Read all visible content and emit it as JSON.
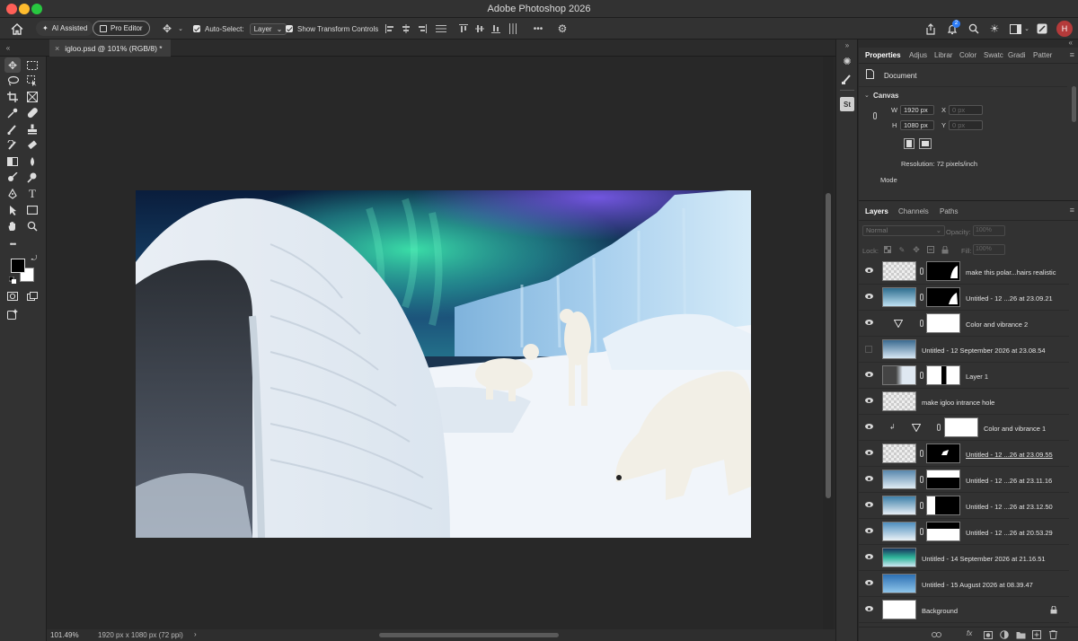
{
  "window": {
    "title": "Adobe Photoshop 2026"
  },
  "options_bar": {
    "ai_assisted": "AI Assisted",
    "pro_editor": "Pro Editor",
    "auto_select_label": "Auto-Select:",
    "auto_select_value": "Layer",
    "show_transform": "Show Transform Controls",
    "more": "•••"
  },
  "document": {
    "tab": "igloo.psd @ 101% (RGB/8) *"
  },
  "status": {
    "zoom": "101.49%",
    "info": "1920 px x 1080 px (72 ppi)",
    "arrow": "›"
  },
  "side_strip": {
    "stock_label": "St"
  },
  "properties": {
    "tabs": [
      "Properties",
      "Adjus",
      "Librar",
      "Color",
      "Swatc",
      "Gradi",
      "Patter"
    ],
    "document_label": "Document",
    "canvas_label": "Canvas",
    "w_label": "W",
    "w_value": "1920 px",
    "h_label": "H",
    "h_value": "1080 px",
    "x_label": "X",
    "x_value": "0 px",
    "y_label": "Y",
    "y_value": "0 px",
    "resolution": "Resolution: 72 pixels/inch",
    "mode_label": "Mode"
  },
  "layers_panel": {
    "tabs": [
      "Layers",
      "Channels",
      "Paths"
    ],
    "blend_mode": "Normal",
    "opacity_label": "Opacity:",
    "opacity_value": "100%",
    "lock_label": "Lock:",
    "fill_label": "Fill:",
    "fill_value": "100%",
    "layers": [
      {
        "name": "make this polar...hairs realistic",
        "visible": true
      },
      {
        "name": "Untitled - 12 ...26 at 23.09.21",
        "visible": true
      },
      {
        "name": "Color and vibrance 2",
        "visible": true
      },
      {
        "name": "Untitled - 12 September 2026 at 23.08.54",
        "visible": false
      },
      {
        "name": "Layer 1",
        "visible": true
      },
      {
        "name": "make igloo intrance hole",
        "visible": true
      },
      {
        "name": "Color and vibrance 1",
        "visible": true
      },
      {
        "name": "Untitled - 12 ...26 at 23.09.55",
        "visible": true
      },
      {
        "name": "Untitled - 12 ...26 at 23.11.16",
        "visible": true
      },
      {
        "name": "Untitled - 12 ...26 at 23.12.50",
        "visible": true
      },
      {
        "name": "Untitled - 12 ...26 at 20.53.29",
        "visible": true
      },
      {
        "name": "Untitled - 14 September 2026 at 21.16.51",
        "visible": true
      },
      {
        "name": "Untitled - 15 August 2026 at 08.39.47",
        "visible": true
      },
      {
        "name": "Background",
        "visible": true
      }
    ],
    "footer_fx": "fx"
  },
  "colors": {
    "foreground": "#000000",
    "background": "#ffffff",
    "accent": "#2d7cf6",
    "panel": "#323232"
  }
}
